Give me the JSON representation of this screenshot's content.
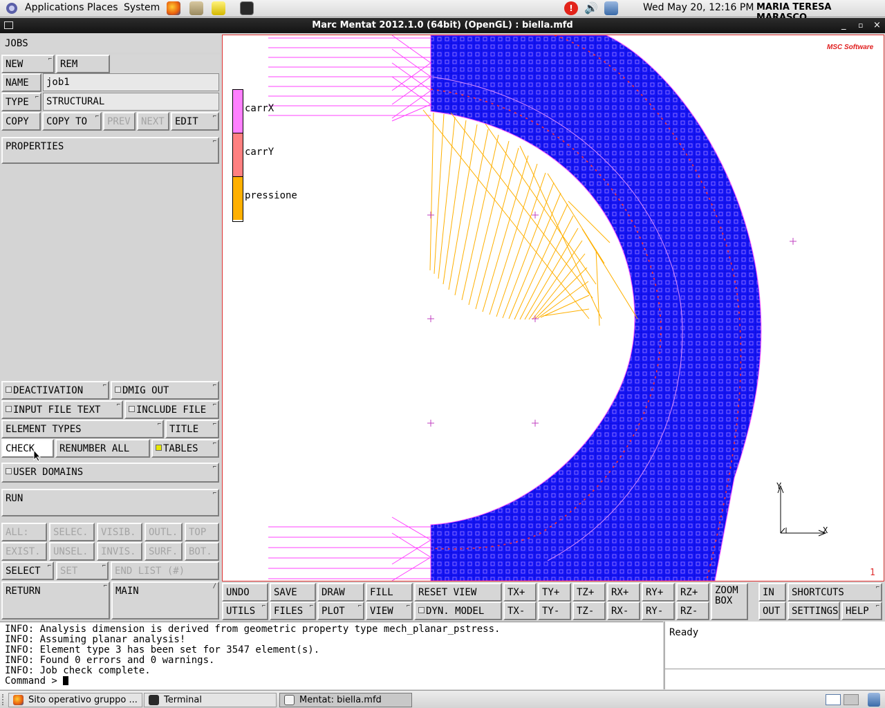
{
  "top_panel": {
    "menus": [
      "Applications",
      "Places",
      "System"
    ],
    "datetime": "Wed May 20, 12:16 PM",
    "user": "MARIA TERESA MARASCO",
    "notification_count": "!"
  },
  "window": {
    "title": "Marc Mentat 2012.1.0 (64bit) (OpenGL) : biella.mfd"
  },
  "left_panel": {
    "header": "JOBS",
    "new_label": "NEW",
    "rem_label": "REM",
    "name_label": "NAME",
    "name_value": "job1",
    "type_label": "TYPE",
    "type_value": "STRUCTURAL",
    "copy_label": "COPY",
    "copy_to_label": "COPY TO",
    "prev_label": "PREV",
    "next_label": "NEXT",
    "edit_label": "EDIT",
    "properties_label": "PROPERTIES",
    "deactivation_label": "DEACTIVATION",
    "dmig_out_label": "DMIG OUT",
    "input_file_text_label": "INPUT FILE TEXT",
    "include_file_label": "INCLUDE FILE",
    "element_types_label": "ELEMENT TYPES",
    "title_label": "TITLE",
    "check_label": "CHECK",
    "renumber_all_label": "RENUMBER ALL",
    "tables_label": "TABLES",
    "user_domains_label": "USER DOMAINS",
    "run_label": "RUN",
    "select_row1": [
      "ALL:",
      "SELEC.",
      "VISIB.",
      "OUTL.",
      "TOP"
    ],
    "select_row2": [
      "EXIST.",
      "UNSEL.",
      "INVIS.",
      "SURF.",
      "BOT."
    ],
    "select_label": "SELECT",
    "set_label": "SET",
    "end_list_label": "END LIST (#)",
    "return_label": "RETURN",
    "main_label": "MAIN"
  },
  "viewport": {
    "logo": "MSC Software",
    "legend": [
      {
        "name": "carrX",
        "color": "#ff80ff"
      },
      {
        "name": "carrY",
        "color": "#ff8080"
      },
      {
        "name": "pressione",
        "color": "#ffb000"
      }
    ],
    "axis_x": "X",
    "axis_y": "Y",
    "viewport_number": "1",
    "mesh_color": "#1a1aff"
  },
  "toolbar": {
    "row1": [
      "UNDO",
      "SAVE",
      "DRAW",
      "FILL",
      "RESET VIEW",
      "TX+",
      "TY+",
      "TZ+",
      "RX+",
      "RY+",
      "RZ+",
      "ZOOM BOX",
      "IN",
      "SHORTCUTS"
    ],
    "row2": [
      "UTILS",
      "FILES",
      "PLOT",
      "VIEW",
      "DYN. MODEL",
      "TX-",
      "TY-",
      "TZ-",
      "RX-",
      "RY-",
      "RZ-",
      "OUT",
      "SETTINGS",
      "HELP"
    ]
  },
  "console": {
    "lines": [
      "INFO: Analysis dimension is derived from geometric property type mech_planar_pstress.",
      "INFO: Assuming planar analysis!",
      "INFO: Element type 3 has been set for 3547 element(s).",
      "INFO: Found 0 errors and 0 warnings.",
      "INFO: Job check complete."
    ],
    "prompt": "Command >"
  },
  "status": {
    "text": "Ready"
  },
  "taskbar": {
    "items": [
      "Sito operativo gruppo ...",
      "Terminal",
      "Mentat: biella.mfd"
    ]
  }
}
